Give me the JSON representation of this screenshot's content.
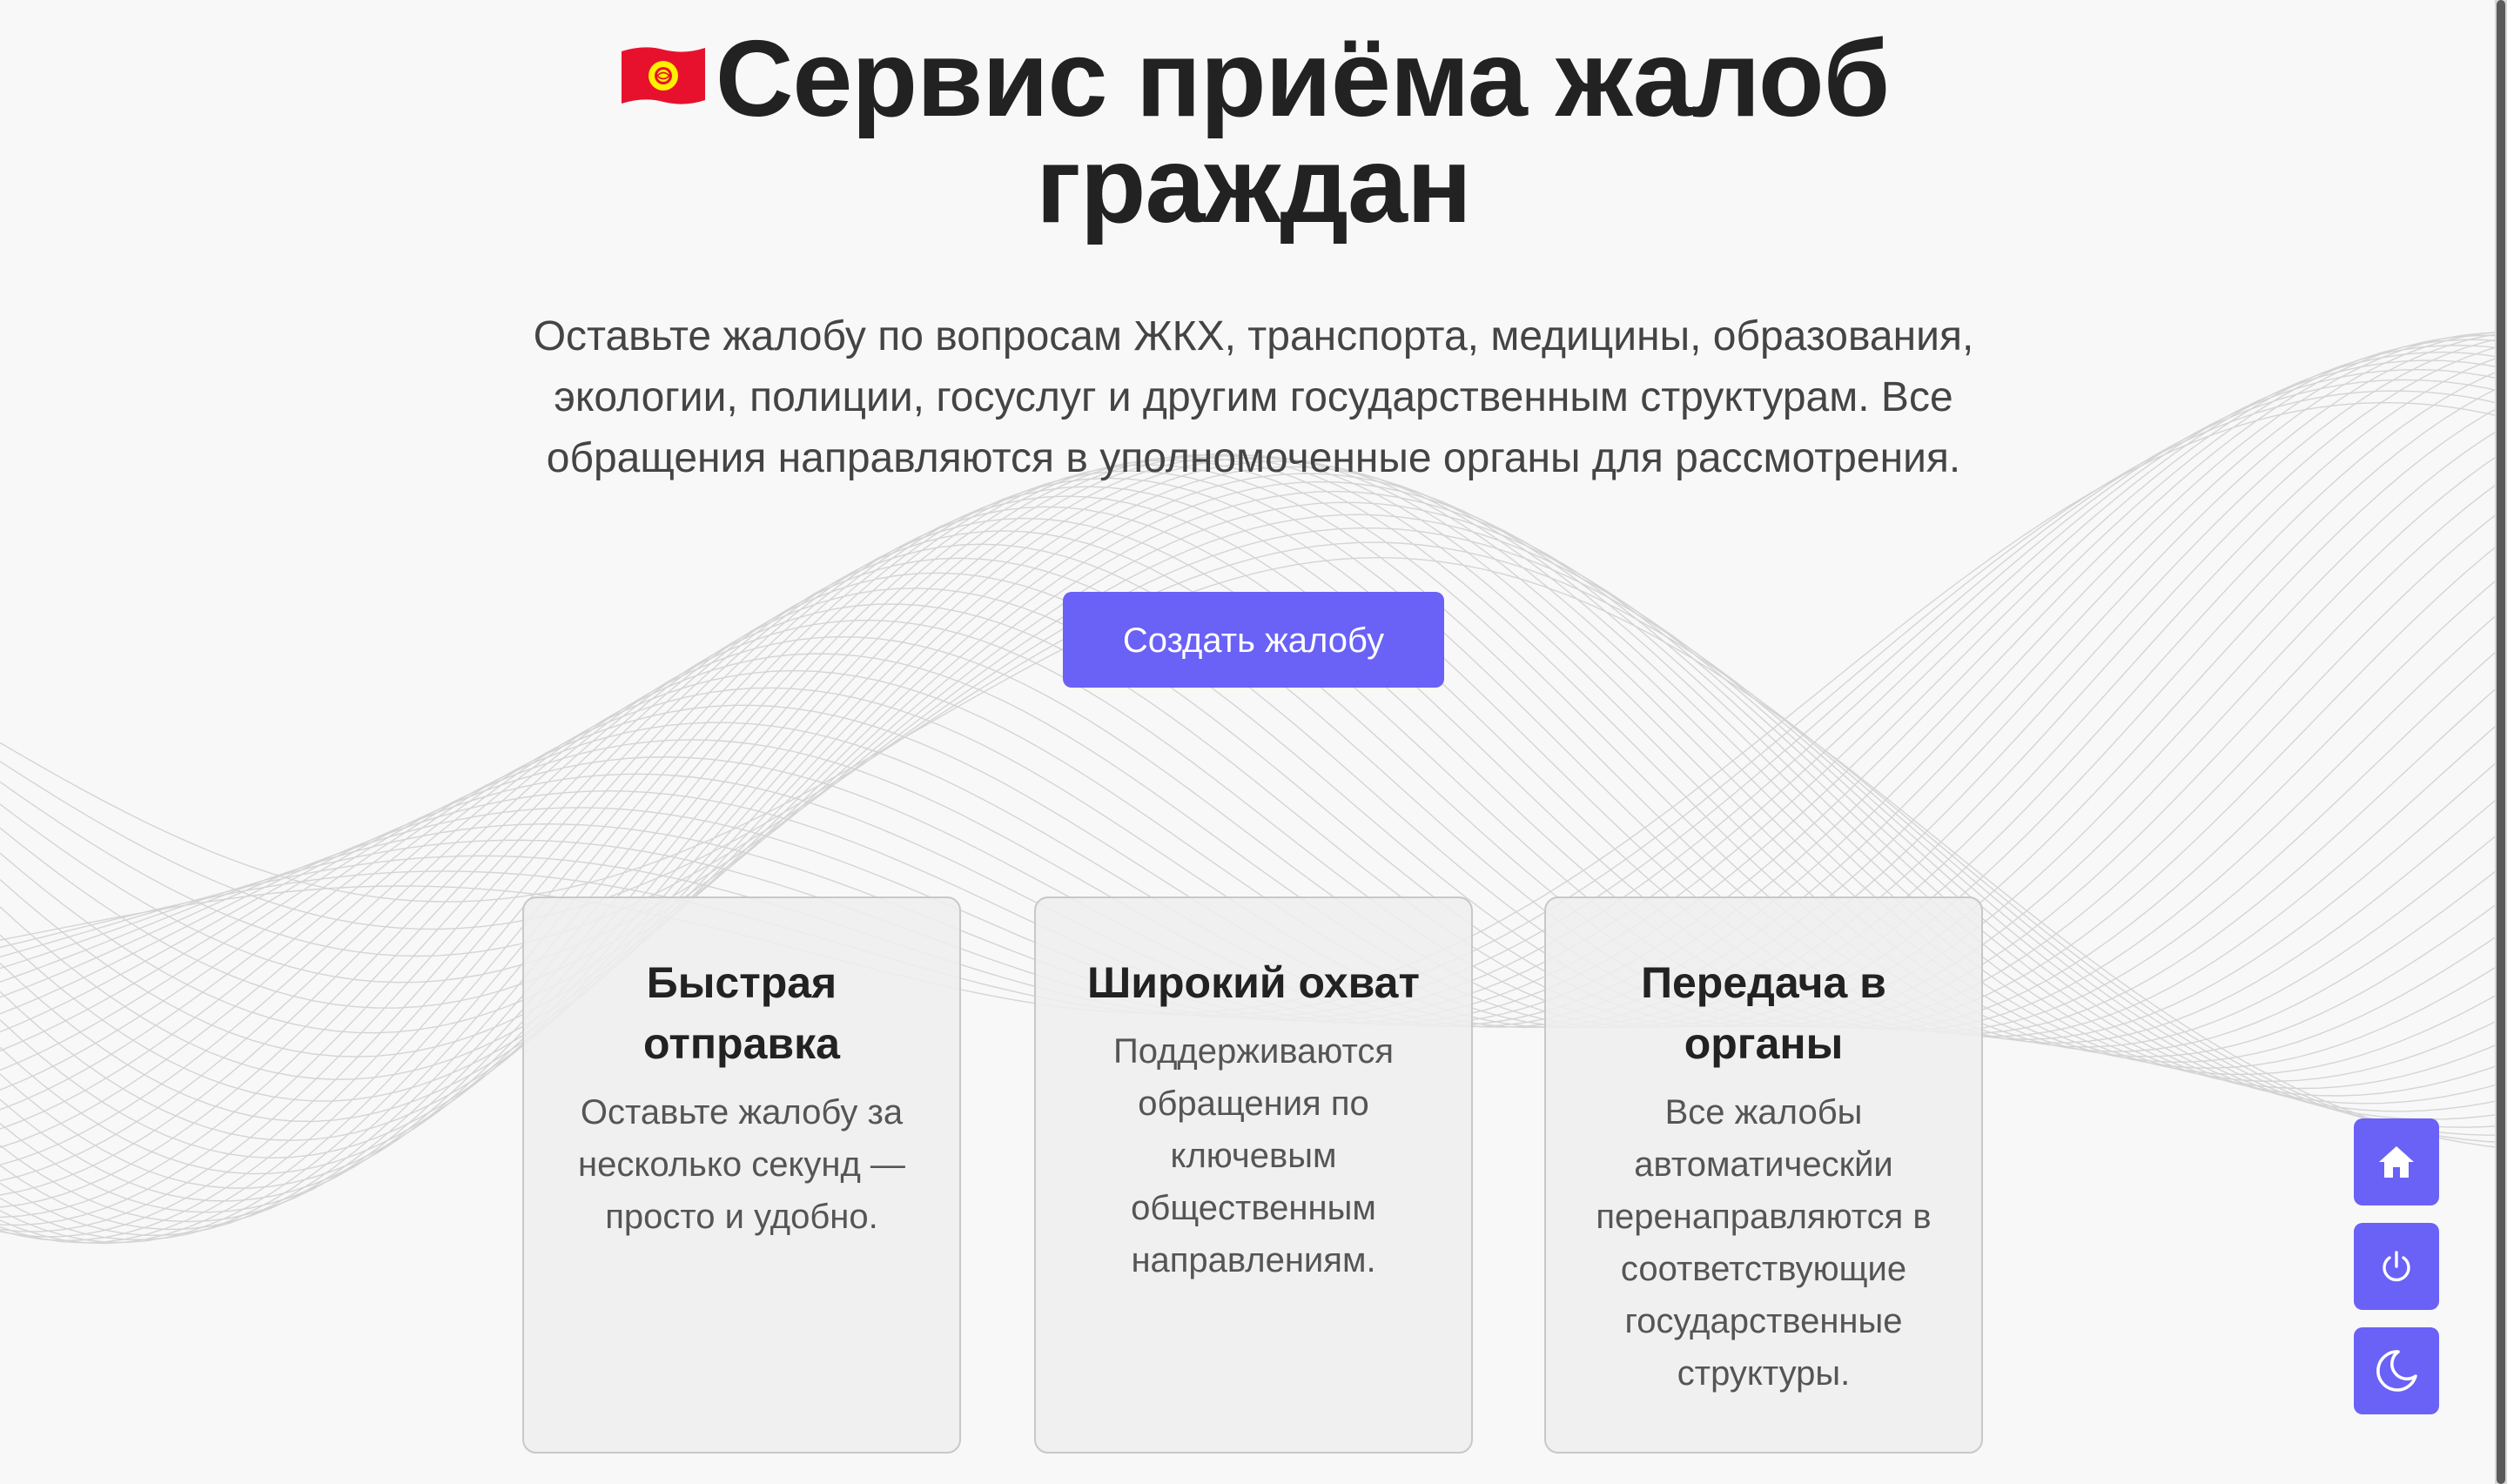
{
  "hero": {
    "title": "Сервис приёма жалоб граждан",
    "subtitle": "Оставьте жалобу по вопросам ЖКХ, транспорта, медицины, образования, экологии, полиции, госуслуг и другим государственным структурам. Все обращения направляются в уполномоченные органы для рассмотрения.",
    "cta_label": "Создать жалобу"
  },
  "cards": [
    {
      "title": "Быстрая отправка",
      "text": "Оставьте жалобу за несколько секунд — просто и удобно."
    },
    {
      "title": "Широкий охват",
      "text": "Поддерживаются обращения по ключевым общественным направлениям."
    },
    {
      "title": "Передача в органы",
      "text": "Все жалобы автоматическйи перенаправляются в соответствующие государственные структуры."
    }
  ],
  "floating_buttons": {
    "home_icon": "home-icon",
    "power_icon": "power-icon",
    "moon_icon": "moon-icon"
  },
  "colors": {
    "accent": "#6a61f6",
    "background": "#f8f8f8",
    "card_background": "#eeeeee",
    "flag_red": "#e8112d",
    "flag_yellow": "#ffef00"
  }
}
